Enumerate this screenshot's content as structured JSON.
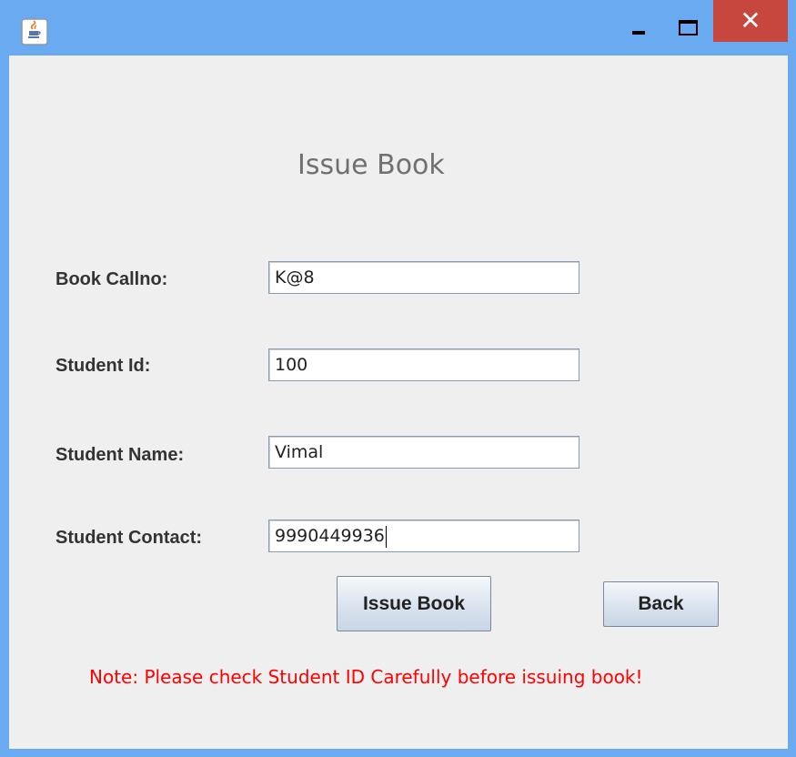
{
  "window": {
    "icons": {
      "app": "java-coffee-cup-icon",
      "minimize": "minimize-icon",
      "maximize": "maximize-icon",
      "close": "close-icon"
    },
    "close_glyph": "✕",
    "colors": {
      "titlebar": "#6aaaf0",
      "close": "#c7473f",
      "content_bg": "#efefef"
    }
  },
  "form": {
    "heading": "Issue Book",
    "fields": [
      {
        "label": "Book Callno:",
        "value": "K@8"
      },
      {
        "label": "Student Id:",
        "value": "100"
      },
      {
        "label": "Student Name:",
        "value": "Vimal"
      },
      {
        "label": "Student Contact:",
        "value": "9990449936"
      }
    ],
    "issue_button": "Issue Book",
    "back_button": "Back",
    "note": "Note: Please check Student ID Carefully before issuing book!",
    "note_color": "#ff0000"
  }
}
